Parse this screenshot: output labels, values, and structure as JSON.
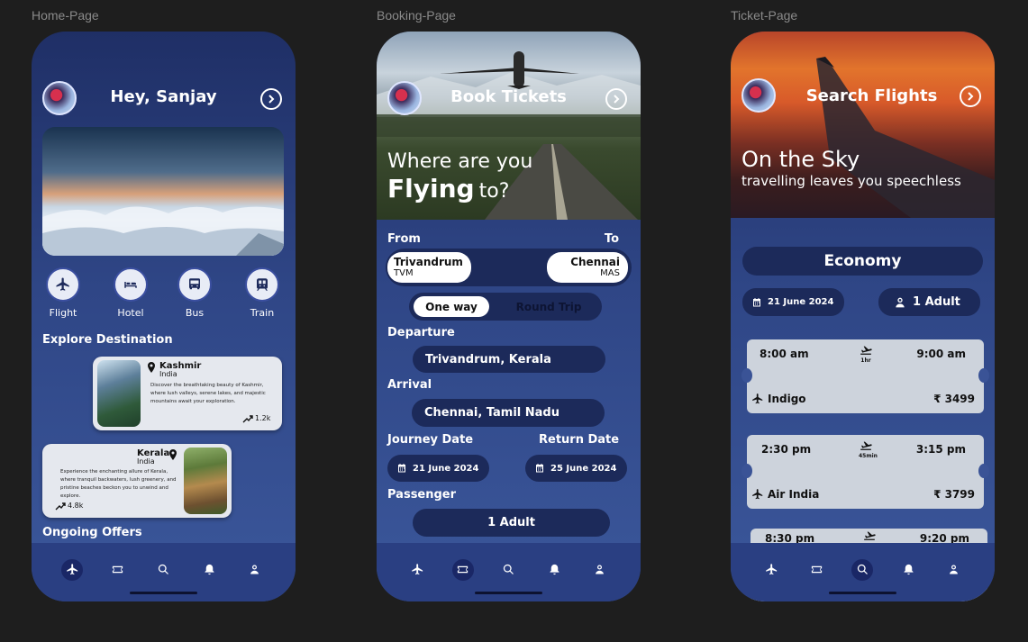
{
  "frames": {
    "home": "Home-Page",
    "booking": "Booking-Page",
    "ticket": "Ticket-Page"
  },
  "home": {
    "greeting": "Hey, Sanjay",
    "categories": [
      {
        "label": "Flight",
        "icon": "plane-icon"
      },
      {
        "label": "Hotel",
        "icon": "bed-icon"
      },
      {
        "label": "Bus",
        "icon": "bus-icon"
      },
      {
        "label": "Train",
        "icon": "train-icon"
      }
    ],
    "explore_title": "Explore Destination",
    "destinations": [
      {
        "name": "Kashmir",
        "country": "India",
        "desc": "Discover the breathtaking beauty of Kashmir, where lush valleys, serene lakes, and majestic mountains await your exploration.",
        "stat": "1.2k"
      },
      {
        "name": "Kerala",
        "country": "India",
        "desc": "Experience the enchanting allure of Kerala, where tranquil backwaters, lush greenery, and pristine beaches beckon you to unwind and explore.",
        "stat": "4.8k"
      }
    ],
    "offers_title": "Ongoing Offers"
  },
  "booking": {
    "title": "Book Tickets",
    "hero_line1": "Where are you",
    "hero_big": "Flying",
    "hero_small": "to?",
    "from_label": "From",
    "to_label": "To",
    "from_city": "Trivandrum",
    "from_code": "TVM",
    "to_city": "Chennai",
    "to_code": "MAS",
    "trip_one": "One way",
    "trip_round": "Round Trip",
    "departure_label": "Departure",
    "departure_value": "Trivandrum, Kerala",
    "arrival_label": "Arrival",
    "arrival_value": "Chennai, Tamil Nadu",
    "journey_label": "Journey Date",
    "return_label": "Return Date",
    "journey_date": "21 June 2024",
    "return_date": "25 June 2024",
    "passenger_label": "Passenger",
    "passenger_value": "1 Adult"
  },
  "ticket": {
    "title": "Search Flights",
    "hero_line1": "On the Sky",
    "hero_line2": "travelling leaves you speechless",
    "class": "Economy",
    "date": "21 June 2024",
    "pax": "1 Adult",
    "flights": [
      {
        "dep": "8:00 am",
        "arr": "9:00 am",
        "dur": "1hr",
        "airline": "Indigo",
        "price": "₹ 3499"
      },
      {
        "dep": "2:30 pm",
        "arr": "3:15 pm",
        "dur": "45min",
        "airline": "Air India",
        "price": "₹ 3799"
      },
      {
        "dep": "8:30 pm",
        "arr": "9:20 pm",
        "dur": "",
        "airline": "",
        "price": ""
      }
    ]
  },
  "colors": {
    "canvas": "#1e1e1e",
    "phone_top": "#1f2f66",
    "phone_bottom": "#3b579b",
    "pill_dark": "#1c2a5a",
    "ticket": "#cdd3dc"
  }
}
